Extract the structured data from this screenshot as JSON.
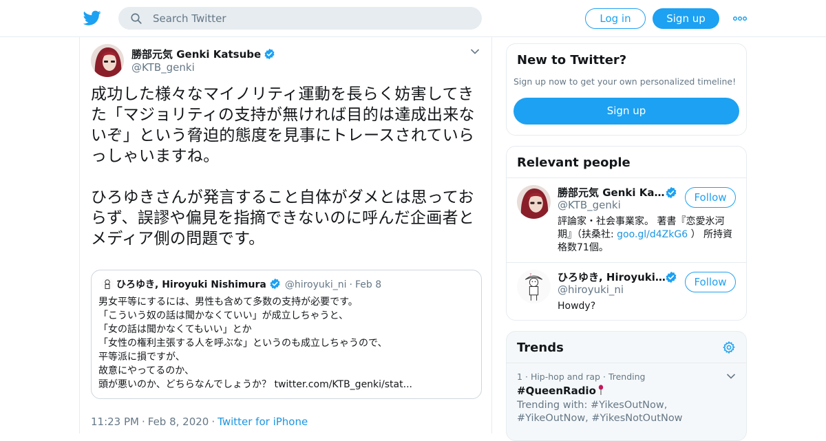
{
  "header": {
    "search_placeholder": "Search Twitter",
    "login_label": "Log in",
    "signup_label": "Sign up"
  },
  "tweet": {
    "author_name": "勝部元気 Genki Katsube",
    "author_handle": "@KTB_genki",
    "text": "成功した様々なマイノリティ運動を長らく妨害してきた「マジョリティの支持が無ければ目的は達成出来ないぞ」という脅迫的態度を見事にトレースされていらっしゃいますね。\n\nひろゆきさんが発言すること自体がダメとは思っておらず、誤謬や偏見を指摘できないのに呼んだ企画者とメディア側の問題です。",
    "time": "11:23 PM",
    "date": "Feb 8, 2020",
    "source": "Twitter for iPhone",
    "quote": {
      "name": "ひろゆき, Hiroyuki Nishimura",
      "handle": "@hiroyuki_ni",
      "date": "Feb 8",
      "text": "男女平等にするには、男性も含めて多数の支持が必要です。\n「こういう奴の話は聞かなくていい」が成立しちゃうと、\n「女の話は聞かなくてもいい」とか\n「女性の権利主張する人を呼ぶな」というのも成立しちゃうので、\n平等派に損ですが、\n故意にやってるのか、\n頭が悪いのか、どちらなんでしょうか？ twitter.com/KTB_genki/stat..."
    }
  },
  "sidebar": {
    "new_to_twitter": {
      "title": "New to Twitter?",
      "subtitle": "Sign up now to get your own personalized timeline!",
      "signup_label": "Sign up"
    },
    "relevant_people": {
      "title": "Relevant people",
      "people": [
        {
          "name": "勝部元気 Genki Katsube",
          "handle": "@KTB_genki",
          "follow_label": "Follow",
          "bio_prefix": "評論家・社会事業家。 著書『恋愛氷河期』（扶桑社: ",
          "bio_link": "goo.gl/d4ZkG6",
          "bio_suffix": " ） 所持資格数71個。"
        },
        {
          "name": "ひろゆき, Hiroyuki Nishimura",
          "handle": "@hiroyuki_ni",
          "follow_label": "Follow",
          "bio": "Howdy?"
        }
      ]
    },
    "trends": {
      "title": "Trends",
      "items": [
        {
          "rank": "1",
          "category": "Hip-hop and rap",
          "status": "Trending",
          "name": "#QueenRadio",
          "trending_with": "Trending with: #YikesOutNow, #YikeOutNow, #YikesNotOutNow"
        }
      ]
    }
  },
  "colors": {
    "accent": "#1da1f2",
    "link": "#1b95e0",
    "secondary_text": "#657786",
    "border": "#e6ecf0"
  }
}
